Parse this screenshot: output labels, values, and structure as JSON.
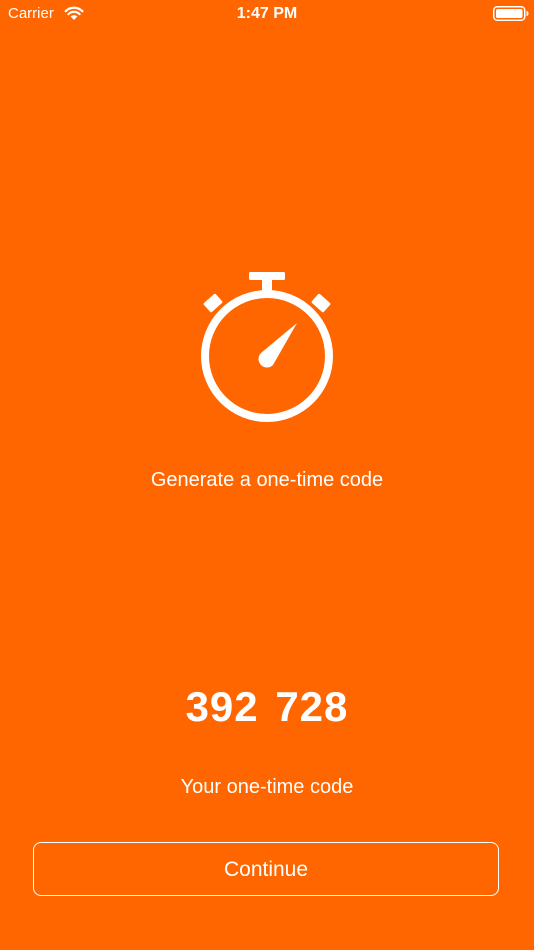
{
  "status_bar": {
    "carrier": "Carrier",
    "time": "1:47 PM",
    "icons": [
      "wifi-icon",
      "battery-icon"
    ]
  },
  "main": {
    "icon": "stopwatch-icon",
    "heading": "Generate a one-time code",
    "code": "392 728",
    "caption": "Your one-time code"
  },
  "footer": {
    "continue_label": "Continue"
  },
  "colors": {
    "background": "#ff6600",
    "foreground": "#ffffff"
  }
}
